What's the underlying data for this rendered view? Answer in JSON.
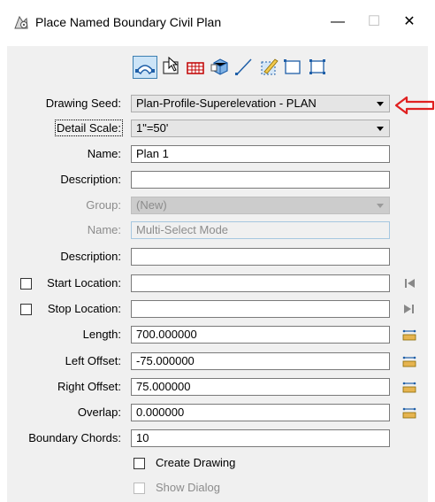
{
  "window": {
    "title": "Place Named Boundary Civil Plan",
    "minimize_glyph": "—",
    "maximize_glyph": "☐",
    "close_glyph": "✕"
  },
  "toolbar": {
    "icons": [
      "civil-plan-icon",
      "profile-icon",
      "cross-section-icon",
      "3d-cut-icon",
      "two-points-icon",
      "from-element-icon",
      "drawing-sheet-icon",
      "clip-volume-icon"
    ],
    "active_index": 0
  },
  "form": {
    "drawing_seed_label": "Drawing Seed:",
    "drawing_seed_value": "Plan-Profile-Superelevation - PLAN",
    "detail_scale_label": "Detail Scale:",
    "detail_scale_value": "1\"=50'",
    "name_label": "Name:",
    "name_value": "Plan 1",
    "description_label": "Description:",
    "description_value": "",
    "group_label": "Group:",
    "group_value": "(New)",
    "group_name_label": "Name:",
    "group_name_value": "Multi-Select Mode",
    "group_description_label": "Description:",
    "group_description_value": "",
    "start_location_label": "Start Location:",
    "start_location_value": "",
    "stop_location_label": "Stop Location:",
    "stop_location_value": "",
    "length_label": "Length:",
    "length_value": "700.000000",
    "left_offset_label": "Left Offset:",
    "left_offset_value": "-75.000000",
    "right_offset_label": "Right Offset:",
    "right_offset_value": "75.000000",
    "overlap_label": "Overlap:",
    "overlap_value": "0.000000",
    "boundary_chords_label": "Boundary Chords:",
    "boundary_chords_value": "10",
    "create_drawing_label": "Create Drawing",
    "show_dialog_label": "Show Dialog"
  },
  "annotation": {
    "arrow_color": "#e02020"
  }
}
